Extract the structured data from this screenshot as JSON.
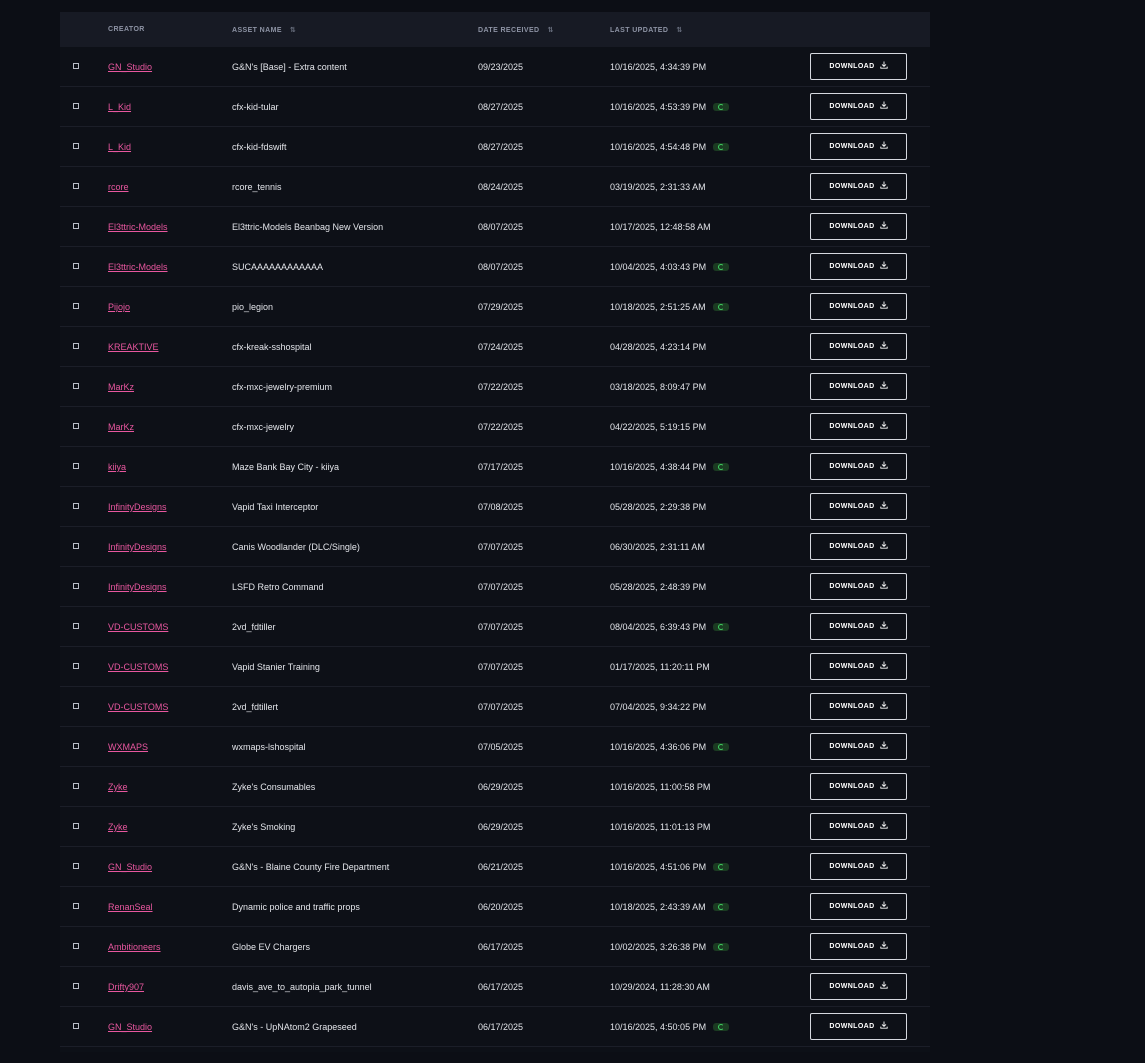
{
  "table": {
    "headers": {
      "creator": "CREATOR",
      "asset_name": "ASSET NAME",
      "date_received": "DATE RECEIVED",
      "last_updated": "LAST UPDATED"
    },
    "sort_glyph": "⇅",
    "download_label": "DOWNLOAD",
    "rows": [
      {
        "creator": "GN_Studio",
        "asset": "G&N's [Base] - Extra content",
        "received": "09/23/2025",
        "updated": "10/16/2025, 4:34:39 PM",
        "synced": false
      },
      {
        "creator": "L_Kid",
        "asset": "cfx-kid-tular",
        "received": "08/27/2025",
        "updated": "10/16/2025, 4:53:39 PM",
        "synced": true
      },
      {
        "creator": "L_Kid",
        "asset": "cfx-kid-fdswift",
        "received": "08/27/2025",
        "updated": "10/16/2025, 4:54:48 PM",
        "synced": true
      },
      {
        "creator": "rcore",
        "asset": "rcore_tennis",
        "received": "08/24/2025",
        "updated": "03/19/2025, 2:31:33 AM",
        "synced": false
      },
      {
        "creator": "El3ttric-Models",
        "asset": "El3ttric-Models Beanbag New Version",
        "received": "08/07/2025",
        "updated": "10/17/2025, 12:48:58 AM",
        "synced": false
      },
      {
        "creator": "El3ttric-Models",
        "asset": "SUCAAAAAAAAAAAA",
        "received": "08/07/2025",
        "updated": "10/04/2025, 4:03:43 PM",
        "synced": true
      },
      {
        "creator": "Pijojo",
        "asset": "pio_legion",
        "received": "07/29/2025",
        "updated": "10/18/2025, 2:51:25 AM",
        "synced": true
      },
      {
        "creator": "KREAKTIVE",
        "asset": "cfx-kreak-sshospital",
        "received": "07/24/2025",
        "updated": "04/28/2025, 4:23:14 PM",
        "synced": false
      },
      {
        "creator": "MarKz",
        "asset": "cfx-mxc-jewelry-premium",
        "received": "07/22/2025",
        "updated": "03/18/2025, 8:09:47 PM",
        "synced": false
      },
      {
        "creator": "MarKz",
        "asset": "cfx-mxc-jewelry",
        "received": "07/22/2025",
        "updated": "04/22/2025, 5:19:15 PM",
        "synced": false
      },
      {
        "creator": "kiiya",
        "asset": "Maze Bank Bay City - kiiya",
        "received": "07/17/2025",
        "updated": "10/16/2025, 4:38:44 PM",
        "synced": true
      },
      {
        "creator": "InfinityDesigns",
        "asset": "Vapid Taxi Interceptor",
        "received": "07/08/2025",
        "updated": "05/28/2025, 2:29:38 PM",
        "synced": false
      },
      {
        "creator": "InfinityDesigns",
        "asset": "Canis Woodlander (DLC/Single)",
        "received": "07/07/2025",
        "updated": "06/30/2025, 2:31:11 AM",
        "synced": false
      },
      {
        "creator": "InfinityDesigns",
        "asset": "LSFD Retro Command",
        "received": "07/07/2025",
        "updated": "05/28/2025, 2:48:39 PM",
        "synced": false
      },
      {
        "creator": "VD-CUSTOMS",
        "asset": "2vd_fdtiller",
        "received": "07/07/2025",
        "updated": "08/04/2025, 6:39:43 PM",
        "synced": true
      },
      {
        "creator": "VD-CUSTOMS",
        "asset": "Vapid Stanier Training",
        "received": "07/07/2025",
        "updated": "01/17/2025, 11:20:11 PM",
        "synced": false
      },
      {
        "creator": "VD-CUSTOMS",
        "asset": "2vd_fdtillert",
        "received": "07/07/2025",
        "updated": "07/04/2025, 9:34:22 PM",
        "synced": false
      },
      {
        "creator": "WXMAPS",
        "asset": "wxmaps-lshospital",
        "received": "07/05/2025",
        "updated": "10/16/2025, 4:36:06 PM",
        "synced": true
      },
      {
        "creator": "Zyke",
        "asset": "Zyke's Consumables",
        "received": "06/29/2025",
        "updated": "10/16/2025, 11:00:58 PM",
        "synced": false
      },
      {
        "creator": "Zyke",
        "asset": "Zyke's Smoking",
        "received": "06/29/2025",
        "updated": "10/16/2025, 11:01:13 PM",
        "synced": false
      },
      {
        "creator": "GN_Studio",
        "asset": "G&N's - Blaine County Fire Department",
        "received": "06/21/2025",
        "updated": "10/16/2025, 4:51:06 PM",
        "synced": true
      },
      {
        "creator": "RenanSeal",
        "asset": "Dynamic police and traffic props",
        "received": "06/20/2025",
        "updated": "10/18/2025, 2:43:39 AM",
        "synced": true
      },
      {
        "creator": "Ambitioneers",
        "asset": "Globe EV Chargers",
        "received": "06/17/2025",
        "updated": "10/02/2025, 3:26:38 PM",
        "synced": true
      },
      {
        "creator": "Drifty907",
        "asset": "davis_ave_to_autopia_park_tunnel",
        "received": "06/17/2025",
        "updated": "10/29/2024, 11:28:30 AM",
        "synced": false
      },
      {
        "creator": "GN_Studio",
        "asset": "G&N's - UpNAtom2 Grapeseed",
        "received": "06/17/2025",
        "updated": "10/16/2025, 4:50:05 PM",
        "synced": true
      }
    ]
  }
}
